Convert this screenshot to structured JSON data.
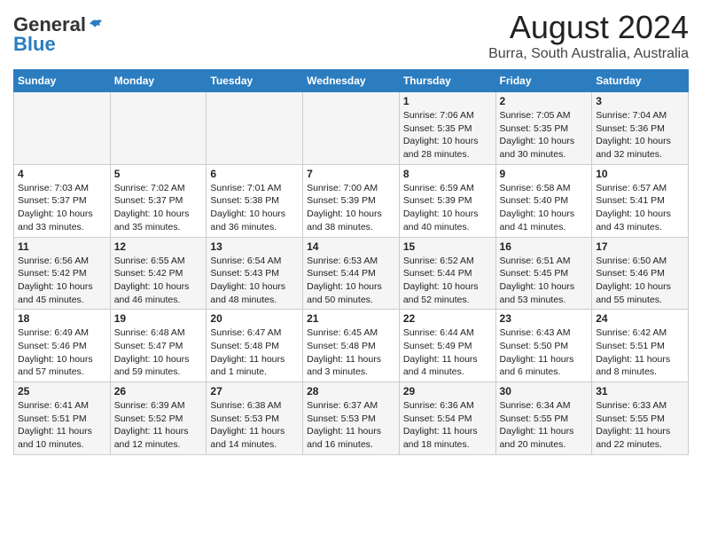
{
  "header": {
    "logo": {
      "general": "General",
      "blue": "Blue",
      "tagline": ""
    },
    "title": "August 2024",
    "subtitle": "Burra, South Australia, Australia"
  },
  "calendar": {
    "weekdays": [
      "Sunday",
      "Monday",
      "Tuesday",
      "Wednesday",
      "Thursday",
      "Friday",
      "Saturday"
    ],
    "weeks": [
      [
        {
          "day": "",
          "info": ""
        },
        {
          "day": "",
          "info": ""
        },
        {
          "day": "",
          "info": ""
        },
        {
          "day": "",
          "info": ""
        },
        {
          "day": "1",
          "info": "Sunrise: 7:06 AM\nSunset: 5:35 PM\nDaylight: 10 hours\nand 28 minutes."
        },
        {
          "day": "2",
          "info": "Sunrise: 7:05 AM\nSunset: 5:35 PM\nDaylight: 10 hours\nand 30 minutes."
        },
        {
          "day": "3",
          "info": "Sunrise: 7:04 AM\nSunset: 5:36 PM\nDaylight: 10 hours\nand 32 minutes."
        }
      ],
      [
        {
          "day": "4",
          "info": "Sunrise: 7:03 AM\nSunset: 5:37 PM\nDaylight: 10 hours\nand 33 minutes."
        },
        {
          "day": "5",
          "info": "Sunrise: 7:02 AM\nSunset: 5:37 PM\nDaylight: 10 hours\nand 35 minutes."
        },
        {
          "day": "6",
          "info": "Sunrise: 7:01 AM\nSunset: 5:38 PM\nDaylight: 10 hours\nand 36 minutes."
        },
        {
          "day": "7",
          "info": "Sunrise: 7:00 AM\nSunset: 5:39 PM\nDaylight: 10 hours\nand 38 minutes."
        },
        {
          "day": "8",
          "info": "Sunrise: 6:59 AM\nSunset: 5:39 PM\nDaylight: 10 hours\nand 40 minutes."
        },
        {
          "day": "9",
          "info": "Sunrise: 6:58 AM\nSunset: 5:40 PM\nDaylight: 10 hours\nand 41 minutes."
        },
        {
          "day": "10",
          "info": "Sunrise: 6:57 AM\nSunset: 5:41 PM\nDaylight: 10 hours\nand 43 minutes."
        }
      ],
      [
        {
          "day": "11",
          "info": "Sunrise: 6:56 AM\nSunset: 5:42 PM\nDaylight: 10 hours\nand 45 minutes."
        },
        {
          "day": "12",
          "info": "Sunrise: 6:55 AM\nSunset: 5:42 PM\nDaylight: 10 hours\nand 46 minutes."
        },
        {
          "day": "13",
          "info": "Sunrise: 6:54 AM\nSunset: 5:43 PM\nDaylight: 10 hours\nand 48 minutes."
        },
        {
          "day": "14",
          "info": "Sunrise: 6:53 AM\nSunset: 5:44 PM\nDaylight: 10 hours\nand 50 minutes."
        },
        {
          "day": "15",
          "info": "Sunrise: 6:52 AM\nSunset: 5:44 PM\nDaylight: 10 hours\nand 52 minutes."
        },
        {
          "day": "16",
          "info": "Sunrise: 6:51 AM\nSunset: 5:45 PM\nDaylight: 10 hours\nand 53 minutes."
        },
        {
          "day": "17",
          "info": "Sunrise: 6:50 AM\nSunset: 5:46 PM\nDaylight: 10 hours\nand 55 minutes."
        }
      ],
      [
        {
          "day": "18",
          "info": "Sunrise: 6:49 AM\nSunset: 5:46 PM\nDaylight: 10 hours\nand 57 minutes."
        },
        {
          "day": "19",
          "info": "Sunrise: 6:48 AM\nSunset: 5:47 PM\nDaylight: 10 hours\nand 59 minutes."
        },
        {
          "day": "20",
          "info": "Sunrise: 6:47 AM\nSunset: 5:48 PM\nDaylight: 11 hours\nand 1 minute."
        },
        {
          "day": "21",
          "info": "Sunrise: 6:45 AM\nSunset: 5:48 PM\nDaylight: 11 hours\nand 3 minutes."
        },
        {
          "day": "22",
          "info": "Sunrise: 6:44 AM\nSunset: 5:49 PM\nDaylight: 11 hours\nand 4 minutes."
        },
        {
          "day": "23",
          "info": "Sunrise: 6:43 AM\nSunset: 5:50 PM\nDaylight: 11 hours\nand 6 minutes."
        },
        {
          "day": "24",
          "info": "Sunrise: 6:42 AM\nSunset: 5:51 PM\nDaylight: 11 hours\nand 8 minutes."
        }
      ],
      [
        {
          "day": "25",
          "info": "Sunrise: 6:41 AM\nSunset: 5:51 PM\nDaylight: 11 hours\nand 10 minutes."
        },
        {
          "day": "26",
          "info": "Sunrise: 6:39 AM\nSunset: 5:52 PM\nDaylight: 11 hours\nand 12 minutes."
        },
        {
          "day": "27",
          "info": "Sunrise: 6:38 AM\nSunset: 5:53 PM\nDaylight: 11 hours\nand 14 minutes."
        },
        {
          "day": "28",
          "info": "Sunrise: 6:37 AM\nSunset: 5:53 PM\nDaylight: 11 hours\nand 16 minutes."
        },
        {
          "day": "29",
          "info": "Sunrise: 6:36 AM\nSunset: 5:54 PM\nDaylight: 11 hours\nand 18 minutes."
        },
        {
          "day": "30",
          "info": "Sunrise: 6:34 AM\nSunset: 5:55 PM\nDaylight: 11 hours\nand 20 minutes."
        },
        {
          "day": "31",
          "info": "Sunrise: 6:33 AM\nSunset: 5:55 PM\nDaylight: 11 hours\nand 22 minutes."
        }
      ]
    ]
  }
}
